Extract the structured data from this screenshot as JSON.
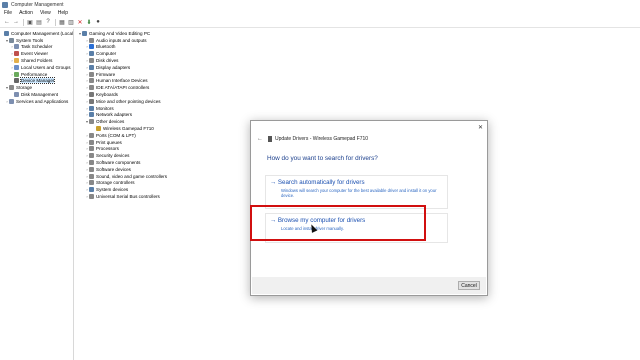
{
  "window": {
    "title": "Computer Management"
  },
  "menu": [
    "File",
    "Action",
    "View",
    "Help"
  ],
  "toolbar": [
    {
      "name": "back-icon",
      "glyph": "←"
    },
    {
      "name": "forward-icon",
      "glyph": "→"
    },
    {
      "name": "up-icon",
      "glyph": "▣"
    },
    {
      "name": "properties-icon",
      "glyph": "▤"
    },
    {
      "name": "help-icon",
      "glyph": "?"
    },
    {
      "name": "scan-hardware-icon",
      "glyph": "▦"
    },
    {
      "name": "update-driver-icon",
      "glyph": "▥"
    },
    {
      "name": "uninstall-icon",
      "glyph": "✕"
    },
    {
      "name": "download-icon",
      "glyph": "⬇"
    },
    {
      "name": "disable-icon",
      "glyph": "●"
    }
  ],
  "left_tree": [
    {
      "label": "Computer Management (Local",
      "level": 0,
      "arrow": "",
      "color": "#5a7fa8"
    },
    {
      "label": "System Tools",
      "level": 1,
      "arrow": "▾",
      "color": "#7a8a9a"
    },
    {
      "label": "Task Scheduler",
      "level": 2,
      "arrow": "›",
      "color": "#7d8fb0"
    },
    {
      "label": "Event Viewer",
      "level": 2,
      "arrow": "›",
      "color": "#c0504d"
    },
    {
      "label": "Shared Folders",
      "level": 2,
      "arrow": "›",
      "color": "#e3b04b"
    },
    {
      "label": "Local Users and Groups",
      "level": 2,
      "arrow": "›",
      "color": "#6b8fc8"
    },
    {
      "label": "Performance",
      "level": 2,
      "arrow": "›",
      "color": "#6aaa5c"
    },
    {
      "label": "Device Manager",
      "level": 2,
      "arrow": "",
      "color": "#666",
      "selected": true
    },
    {
      "label": "Storage",
      "level": 1,
      "arrow": "▾",
      "color": "#8a8a8a"
    },
    {
      "label": "Disk Management",
      "level": 2,
      "arrow": "",
      "color": "#7d8fb0"
    },
    {
      "label": "Services and Applications",
      "level": 1,
      "arrow": "›",
      "color": "#7d8fb0"
    }
  ],
  "device_tree": [
    {
      "label": "Gaming And Video Editing PC",
      "level": 0,
      "arrow": "▾",
      "color": "#5a7fa8"
    },
    {
      "label": "Audio inputs and outputs",
      "level": 1,
      "arrow": "›",
      "color": "#888"
    },
    {
      "label": "Bluetooth",
      "level": 1,
      "arrow": "›",
      "color": "#2a6fd6"
    },
    {
      "label": "Computer",
      "level": 1,
      "arrow": "›",
      "color": "#5a7fa8"
    },
    {
      "label": "Disk drives",
      "level": 1,
      "arrow": "›",
      "color": "#888"
    },
    {
      "label": "Display adapters",
      "level": 1,
      "arrow": "›",
      "color": "#5a7fa8"
    },
    {
      "label": "Firmware",
      "level": 1,
      "arrow": "›",
      "color": "#888"
    },
    {
      "label": "Human Interface Devices",
      "level": 1,
      "arrow": "›",
      "color": "#888"
    },
    {
      "label": "IDE ATA/ATAPI controllers",
      "level": 1,
      "arrow": "›",
      "color": "#888"
    },
    {
      "label": "Keyboards",
      "level": 1,
      "arrow": "›",
      "color": "#777"
    },
    {
      "label": "Mice and other pointing devices",
      "level": 1,
      "arrow": "›",
      "color": "#777"
    },
    {
      "label": "Monitors",
      "level": 1,
      "arrow": "›",
      "color": "#5a7fa8"
    },
    {
      "label": "Network adapters",
      "level": 1,
      "arrow": "›",
      "color": "#5a7fa8"
    },
    {
      "label": "Other devices",
      "level": 1,
      "arrow": "▾",
      "color": "#888"
    },
    {
      "label": "Wireless Gamepad F710",
      "level": 2,
      "arrow": "",
      "color": "#c9a02c"
    },
    {
      "label": "Ports (COM & LPT)",
      "level": 1,
      "arrow": "›",
      "color": "#888"
    },
    {
      "label": "Print queues",
      "level": 1,
      "arrow": "›",
      "color": "#888"
    },
    {
      "label": "Processors",
      "level": 1,
      "arrow": "›",
      "color": "#888"
    },
    {
      "label": "Security devices",
      "level": 1,
      "arrow": "›",
      "color": "#888"
    },
    {
      "label": "Software components",
      "level": 1,
      "arrow": "›",
      "color": "#888"
    },
    {
      "label": "Software devices",
      "level": 1,
      "arrow": "›",
      "color": "#888"
    },
    {
      "label": "Sound, video and game controllers",
      "level": 1,
      "arrow": "›",
      "color": "#888"
    },
    {
      "label": "Storage controllers",
      "level": 1,
      "arrow": "›",
      "color": "#888"
    },
    {
      "label": "System devices",
      "level": 1,
      "arrow": "›",
      "color": "#5a7fa8"
    },
    {
      "label": "Universal Serial Bus controllers",
      "level": 1,
      "arrow": "›",
      "color": "#888"
    }
  ],
  "dialog": {
    "header": "Update Drivers - Wireless Gamepad F710",
    "question": "How do you want to search for drivers?",
    "auto_title": "Search automatically for drivers",
    "auto_desc": "Windows will search your computer for the best available driver and install it on your device.",
    "browse_title": "Browse my computer for drivers",
    "browse_desc": "Locate and install driver manually.",
    "cancel_label": "Cancel",
    "close_glyph": "✕",
    "back_glyph": "←",
    "arrow_glyph": "→"
  }
}
